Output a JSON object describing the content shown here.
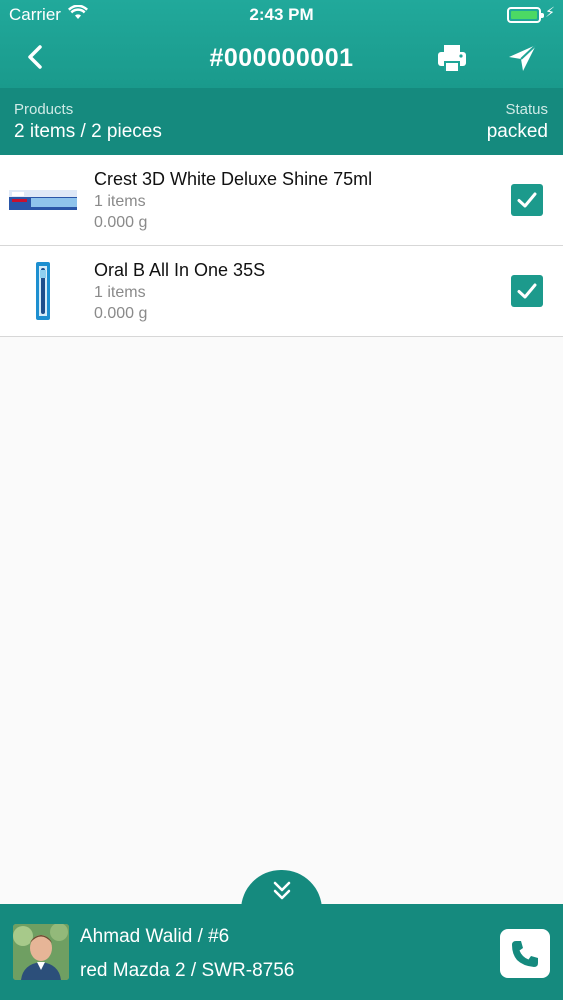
{
  "status_bar": {
    "carrier": "Carrier",
    "time": "2:43 PM",
    "battery_level": 1.0
  },
  "nav": {
    "title": "#000000001",
    "back_icon": "chevron-left-icon",
    "print_icon": "printer-icon",
    "send_icon": "paper-plane-icon"
  },
  "summary": {
    "products_label": "Products",
    "products_value": "2 items / 2 pieces",
    "status_label": "Status",
    "status_value": "packed"
  },
  "products": [
    {
      "name": "Crest 3D White Deluxe Shine 75ml",
      "quantity": "1 items",
      "weight": "0.000 g",
      "checked": true,
      "image": "toothpaste-image"
    },
    {
      "name": "Oral B All In One 35S",
      "quantity": "1 items",
      "weight": "0.000 g",
      "checked": true,
      "image": "toothbrush-image"
    }
  ],
  "driver": {
    "name": "Ahmad Walid / #6",
    "vehicle": "red Mazda 2 / SWR-8756",
    "call_icon": "phone-icon"
  },
  "colors": {
    "header": "#1fa597",
    "summary": "#158a7e",
    "accent": "#1c9a8c",
    "battery": "#4cd964"
  }
}
